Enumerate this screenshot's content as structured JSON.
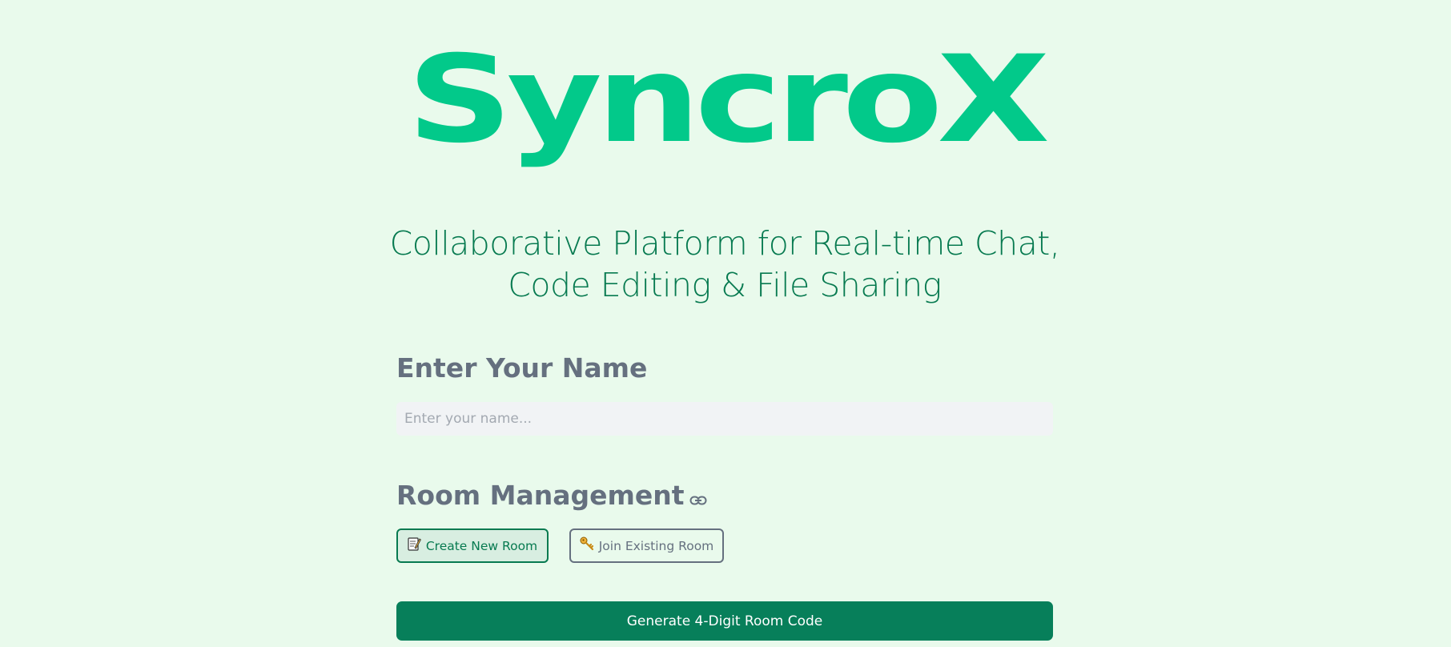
{
  "brand": {
    "logo_text": "SyncroX",
    "logo_color": "#02c98a"
  },
  "tagline": {
    "line1": "Collaborative Platform for Real-time Chat,",
    "line2": "Code Editing & File Sharing"
  },
  "name_section": {
    "title": "Enter Your Name",
    "input_value": "",
    "input_placeholder": "Enter your name..."
  },
  "room_section": {
    "title": "Room Management",
    "title_icon": "link-icon",
    "create_button": {
      "icon": "memo-icon",
      "label": "Create New Room"
    },
    "join_button": {
      "icon": "key-icon",
      "label": "Join Existing Room"
    },
    "generate_button": {
      "label": "Generate 4-Digit Room Code"
    }
  },
  "colors": {
    "background": "#e9faec",
    "primary": "#077a50",
    "accent": "#02c98a",
    "muted_text": "#65707f",
    "input_bg": "#f1f3f5"
  }
}
